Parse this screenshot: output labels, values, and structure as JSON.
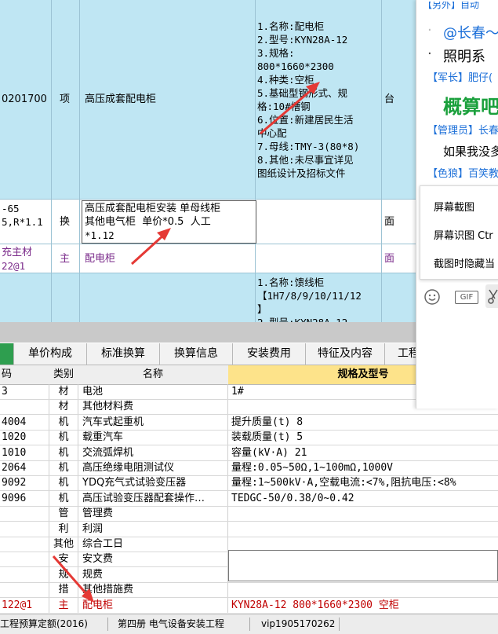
{
  "upper": {
    "row1": {
      "code": "0201700",
      "type": "项",
      "name": "高压成套配电柜",
      "spec_lines": [
        "1.名称:配电柜",
        "2.型号:KYN28A-12",
        "3.规格:",
        "800*1660*2300",
        "4.种类:空柜",
        "5.基础型钢形式、规",
        "格:10#槽钢",
        "6.位置:新建居民生活",
        "中心配",
        "7.母线:TMY-3(80*8)",
        "8.其他:未尽事宜详见",
        "图纸设计及招标文件"
      ],
      "unit": "台"
    },
    "row2": {
      "code_lines": [
        "-65",
        "5,R*1.1"
      ],
      "type": "换",
      "name_lines": [
        "高压成套配电柜安装 单母线柜",
        "其他电气柜  单价*0.5  人工",
        "*1.12"
      ],
      "unit": "面"
    },
    "row3": {
      "code_lines": [
        "充主材",
        "22@1"
      ],
      "type": "主",
      "name": "配电柜",
      "unit": "面"
    },
    "row4": {
      "spec_lines": [
        "1.名称:馈线柜",
        "【1H7/8/9/10/11/12",
        "】",
        "2.型号:KYN28A-12"
      ]
    }
  },
  "tabs": [
    {
      "label": "",
      "active": true
    },
    {
      "label": "单价构成",
      "active": false
    },
    {
      "label": "标准换算",
      "active": false
    },
    {
      "label": "换算信息",
      "active": false
    },
    {
      "label": "安装费用",
      "active": false
    },
    {
      "label": "特征及内容",
      "active": false
    },
    {
      "label": "工程",
      "active": false
    }
  ],
  "lower": {
    "headers": {
      "code": "码",
      "type": "类别",
      "name": "名称",
      "spec": "规格及型号"
    },
    "rows": [
      {
        "code": "3",
        "type": "材",
        "name": "电池",
        "spec": "1#"
      },
      {
        "code": "",
        "type": "材",
        "name": "其他材料费",
        "spec": ""
      },
      {
        "code": "4004",
        "type": "机",
        "name": "汽车式起重机",
        "spec": "提升质量(t) 8"
      },
      {
        "code": "1020",
        "type": "机",
        "name": "载重汽车",
        "spec": "装载质量(t) 5"
      },
      {
        "code": "1010",
        "type": "机",
        "name": "交流弧焊机",
        "spec": "容量(kV·A) 21"
      },
      {
        "code": "2064",
        "type": "机",
        "name": "高压绝缘电阻测试仪",
        "spec": "量程:0.05~50Ω,1~100mΩ,1000V"
      },
      {
        "code": "9092",
        "type": "机",
        "name": "YDQ充气式试验变压器",
        "spec": "量程:1~500kV·A,空载电流:<7%,阻抗电压:<8%"
      },
      {
        "code": "9096",
        "type": "机",
        "name": "高压试验变压器配套操作…",
        "spec": "TEDGC-50/0.38/0~0.42"
      },
      {
        "code": "",
        "type": "管",
        "name": "管理费",
        "spec": ""
      },
      {
        "code": "",
        "type": "利",
        "name": "利润",
        "spec": ""
      },
      {
        "code": "",
        "type": "其他",
        "name": "综合工日",
        "spec": ""
      },
      {
        "code": "",
        "type": "安",
        "name": "安文费",
        "spec": ""
      },
      {
        "code": "",
        "type": "规",
        "name": "规费",
        "spec": ""
      },
      {
        "code": "",
        "type": "措",
        "name": "其他措施费",
        "spec": ""
      },
      {
        "code": "122@1",
        "type": "主",
        "name": "配电柜",
        "spec": "KYN28A-12 800*1660*2300 空柜"
      }
    ]
  },
  "status": {
    "item1": "工程预算定额(2016)",
    "item2": "第四册 电气设备安装工程",
    "item3": "vip1905170262"
  },
  "chat": {
    "top_fragment": "【另外】自动",
    "mention": "@长春～",
    "lighting": "照明系",
    "user1": "【军长】肥仔(",
    "big_text": "概算吧",
    "user2": "【管理员】长春",
    "msg2": "如果我没多",
    "user3": "【色狼】百笑教",
    "emoji_icon": "smiley-icon",
    "gif_label": "GIF",
    "scissors_icon": "scissors-icon"
  },
  "context_menu": {
    "items": [
      "屏幕截图",
      "屏幕识图 Ctr",
      "截图时隐藏当"
    ]
  },
  "colors": {
    "upper_bg": "#bfe6f3",
    "active_tab": "#2e9e4f",
    "spec_header": "#fde38a",
    "arrow": "#e53935",
    "main_material": "#7a2a8a",
    "chat_blue": "#1a6ed8",
    "chat_green": "#1aa03c"
  }
}
